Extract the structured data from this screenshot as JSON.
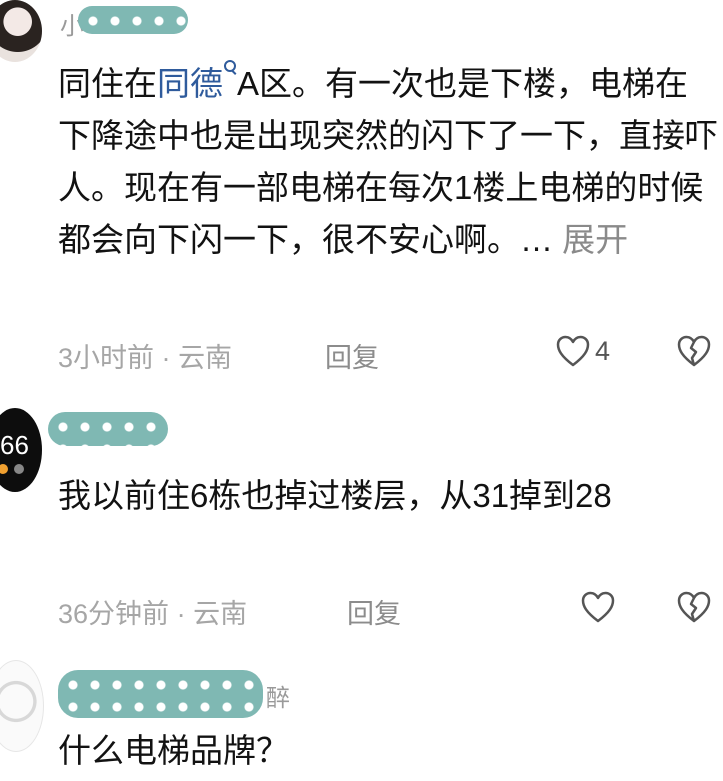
{
  "comments": [
    {
      "username_partial": "小",
      "text_before": "同住在",
      "link": "同德",
      "text_after": "A区。有一次也是下楼，电梯在下降途中也是出现突然的闪下了一下，直接吓人。现在有一部电梯在每次1楼上电梯的时候都会向下闪一下，很不安心啊。… ",
      "expand": "展开",
      "time": "3小时前",
      "separator": "·",
      "location": "云南",
      "reply": "回复",
      "likes": "4"
    },
    {
      "avatar_text": "66",
      "text": "我以前住6栋也掉过楼层，从31掉到28",
      "time": "36分钟前",
      "separator": "·",
      "location": "云南",
      "reply": "回复"
    },
    {
      "username_partial": "醉",
      "text": "什么电梯品牌？"
    }
  ],
  "colors": {
    "link": "#2f5b9c",
    "sticker": "#7fb8b3",
    "meta": "#a6a6a6"
  },
  "icons": [
    "search-icon",
    "heart-icon",
    "broken-heart-icon"
  ]
}
